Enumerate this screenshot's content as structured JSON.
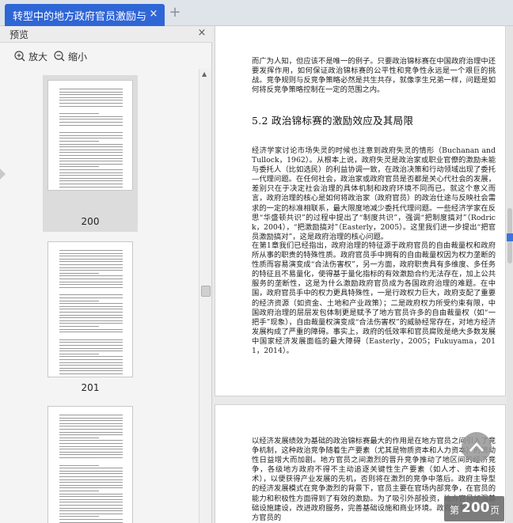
{
  "tab": {
    "title": "转型中的地方政府官员激励与治理",
    "close": "×",
    "add": "+"
  },
  "panel": {
    "title": "预览",
    "close": "×",
    "zoom_in": "放大",
    "zoom_out": "缩小",
    "thumbnails": [
      {
        "page": "200"
      },
      {
        "page": "201"
      }
    ]
  },
  "document": {
    "intro": "而广为人知，但应该不是唯一的例子。只要政治锦标赛在中国政府治理中还要发挥作用，如何保证政治锦标赛的公平性和竞争性永远是一个艰巨的挑战。竞争规则与反竞争策略必然是共生共存，就像李生兄弟一样，问题是如何将反竞争策略控制在一定的范围之内。",
    "heading": "5.2  政治锦标赛的激励效应及其局限",
    "para_a": "经济学家讨论市场失灵的时候也注意到政府失灵的情形（Buchanan and Tullock，1962）。从根本上说，政府失灵是政治家或职业官僚的激励未能与委托人（比如选民）的利益协调一致，在政治决策和行动领域出现了委托—代理问题。在任何社会，政治家或政府官员是否都是关心代社会的发展，差别只在于决定社会治理的具体机制和政府环境不同而已。就这个意义而言，政府治理的核心是如何将政治家（政府官员）的政治仕途与反映社会需求的一定的标准相联系，最大限度地减少委托代理问题。一些经济学家在反思“华盛顿共识”的过程中提出了“制度共识”，强调“把制度搞对”（Rodrick，2004），“把激励搞对”（Easterly，2005）。这里我们进一步提出“把官员激励搞对”，这是政府治理的核心问题。",
    "para_b": "在第1章我们已经指出，政府治理的特征源于政府官员的自由裁量权和政府所从事的职责的特殊性质。政府官员手中拥有的自由裁量权因为权力垄断的性质而容易演变成“合法伤害权”，另一方面，政府职责具有多维度、多任务的特征且不易量化，使得基于量化指标的有效激励合约无法存在，加上公共服务的垄断性，这是为什么激励政府官员成为各国政府治理的难题。在中国，政府官员手中的权力更具特殊性，一是行政权力巨大，政府支配了重要的经济资源（如资金、土地和产业政策）；二是政府权力所受约束有限，中国政府治理的层层发包体制更是赋予了地方官员许多的自由裁量权（如“一把手”现象），自由裁量权演变成“合法伤害权”的威胁经常存在，对地方经济发展构成了严重的障碍。事实上，政府的低效率和官员腐败是绝大多数发展中国家经济发展面临的最大障碍（Easterly，2005；Fukuyama，2011，2014）。",
    "para_c": "以经济发展绩效为基础的政治锦标赛最大的作用是在地方官员之间引入了竞争机制，这种政治竞争随着生产要素（尤其是物质资本和人力资本）的流动性日益增大而加剧。地方官员之间激烈的晋升竞争推动了地区间的经济竞争，各级地方政府不得不主动追逐关键性生产要素（如人才、资本和技术），以便获得产业发展的先机，否则将在激烈的竞争中落后。政府主导型的经济发展模式在竞争激烈的背景下，官员主要在官场内部竞争，在官员的能力和积极性方面得到了有效的激励。为了吸引外部投资，地方官员加强基础设施建设，改进政府服务，完善基础设施和商业环境。政府竞争激发了地方官员的"
  },
  "status": {
    "page_prefix": "第",
    "page_number": "200",
    "page_suffix": "页"
  },
  "colors": {
    "tab_active": "#2f66d6",
    "scroll_marker": "#3c74d8"
  },
  "icons": [
    "close-icon",
    "add-tab-icon",
    "zoom-in-icon",
    "zoom-out-icon",
    "back-to-top-icon"
  ]
}
